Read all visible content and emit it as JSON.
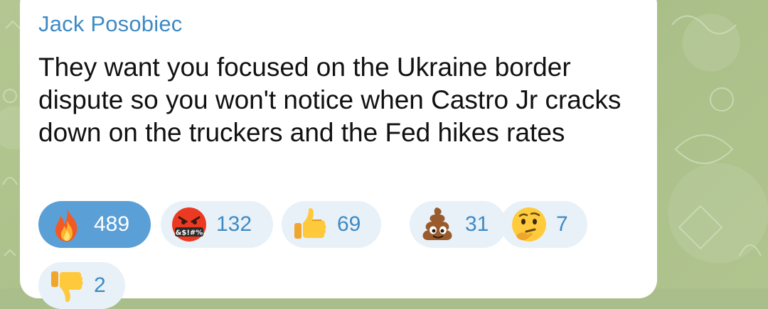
{
  "message": {
    "sender": "Jack Posobiec",
    "text": "They want you focused on the Ukraine border dispute so you won't notice when Castro Jr cracks down on the truckers and the Fed hikes rates"
  },
  "reactions": [
    {
      "icon": "fire-emoji-icon",
      "count": "489",
      "active": true
    },
    {
      "icon": "angry-cursing-emoji-icon",
      "count": "132",
      "active": false
    },
    {
      "icon": "thumbs-up-emoji-icon",
      "count": "69",
      "active": false
    },
    {
      "icon": "pile-of-poo-emoji-icon",
      "count": "31",
      "active": false
    },
    {
      "icon": "thinking-face-emoji-icon",
      "count": "7",
      "active": false
    },
    {
      "icon": "thumbs-down-emoji-icon",
      "count": "2",
      "active": false
    }
  ],
  "colors": {
    "sender": "#3f8ac4",
    "active_reaction": "#5b9fd7",
    "inactive_reaction": "#e8f1f8",
    "bubble": "#ffffff",
    "wallpaper": "#a9be8a"
  }
}
